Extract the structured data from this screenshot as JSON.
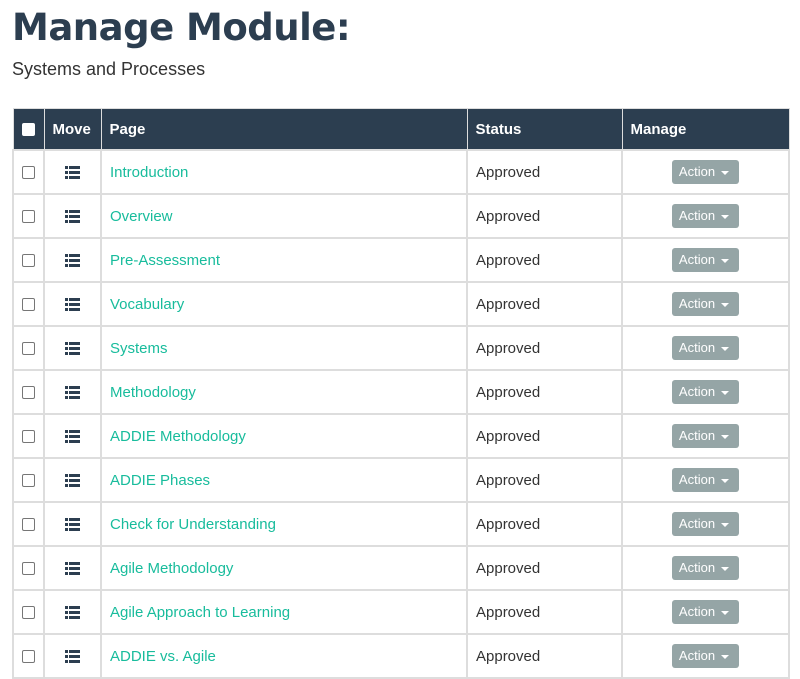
{
  "header": {
    "title": "Manage Module:",
    "subtitle": "Systems and Processes"
  },
  "table": {
    "columns": {
      "move": "Move",
      "page": "Page",
      "status": "Status",
      "manage": "Manage"
    },
    "rows": [
      {
        "page": "Introduction",
        "status": "Approved",
        "action": "Action"
      },
      {
        "page": "Overview",
        "status": "Approved",
        "action": "Action"
      },
      {
        "page": "Pre-Assessment",
        "status": "Approved",
        "action": "Action"
      },
      {
        "page": "Vocabulary",
        "status": "Approved",
        "action": "Action"
      },
      {
        "page": "Systems",
        "status": "Approved",
        "action": "Action"
      },
      {
        "page": "Methodology",
        "status": "Approved",
        "action": "Action"
      },
      {
        "page": "ADDIE Methodology",
        "status": "Approved",
        "action": "Action"
      },
      {
        "page": "ADDIE Phases",
        "status": "Approved",
        "action": "Action"
      },
      {
        "page": "Check for Understanding",
        "status": "Approved",
        "action": "Action"
      },
      {
        "page": "Agile Methodology",
        "status": "Approved",
        "action": "Action"
      },
      {
        "page": "Agile Approach to Learning",
        "status": "Approved",
        "action": "Action"
      },
      {
        "page": "ADDIE vs. Agile",
        "status": "Approved",
        "action": "Action"
      }
    ]
  },
  "icons": {
    "move": "list-icon",
    "select": "checkbox-icon",
    "dropdown": "caret-down-icon"
  },
  "colors": {
    "header_bg": "#2c3e50",
    "link": "#18bc9c",
    "action_button": "#95a5a6",
    "title": "#2c3e50"
  }
}
